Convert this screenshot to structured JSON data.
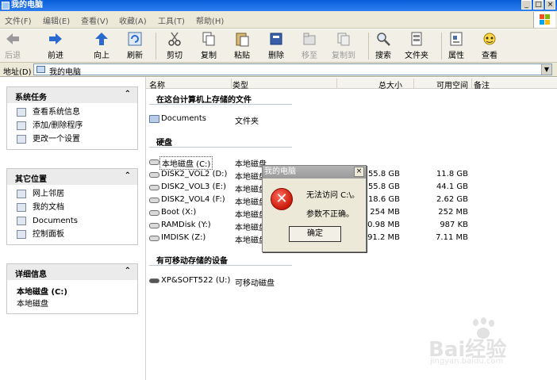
{
  "window": {
    "title": "我的电脑"
  },
  "menu": [
    {
      "label": "文件(F)"
    },
    {
      "label": "编辑(E)"
    },
    {
      "label": "查看(V)"
    },
    {
      "label": "收藏(A)"
    },
    {
      "label": "工具(T)"
    },
    {
      "label": "帮助(H)"
    }
  ],
  "toolbar": {
    "back": "后退",
    "forward": "前进",
    "up": "向上",
    "refresh": "刷新",
    "cut": "剪切",
    "copy": "复制",
    "paste": "粘贴",
    "delete": "删除",
    "move_to": "移至",
    "copy_to": "复制到",
    "search": "搜索",
    "folders": "文件夹",
    "properties": "属性",
    "view": "查看"
  },
  "address": {
    "label": "地址(D)",
    "value": "我的电脑"
  },
  "tasks_panel": {
    "title": "系统任务",
    "items": [
      {
        "label": "查看系统信息",
        "icon": "system-info-icon"
      },
      {
        "label": "添加/删除程序",
        "icon": "add-remove-programs-icon"
      },
      {
        "label": "更改一个设置",
        "icon": "change-setting-icon"
      }
    ]
  },
  "places_panel": {
    "title": "其它位置",
    "items": [
      {
        "label": "网上邻居",
        "icon": "network-icon"
      },
      {
        "label": "我的文档",
        "icon": "documents-icon"
      },
      {
        "label": "Documents",
        "icon": "folder-icon"
      },
      {
        "label": "控制面板",
        "icon": "control-panel-icon"
      }
    ]
  },
  "details_panel": {
    "title": "详细信息",
    "name": "本地磁盘 (C:)",
    "type": "本地磁盘"
  },
  "columns": {
    "name": "名称",
    "type": "类型",
    "total": "总大小",
    "free": "可用空间",
    "note": "备注"
  },
  "groups": {
    "stored_files": "在这台计算机上存储的文件",
    "hard_disks": "硬盘",
    "removable": "有可移动存储的设备"
  },
  "stored_files": [
    {
      "name": "Documents",
      "type": "文件夹"
    }
  ],
  "drives": [
    {
      "name": "本地磁盘 (C:)",
      "type": "本地磁盘",
      "total": "",
      "free": ""
    },
    {
      "name": "DISK2_VOL2 (D:)",
      "type": "本地磁盘",
      "total": "55.8 GB",
      "free": "11.8 GB"
    },
    {
      "name": "DISK2_VOL3 (E:)",
      "type": "本地磁盘",
      "total": "55.8 GB",
      "free": "44.1 GB"
    },
    {
      "name": "DISK2_VOL4 (F:)",
      "type": "本地磁盘",
      "total": "18.6 GB",
      "free": "2.62 GB"
    },
    {
      "name": "Boot (X:)",
      "type": "本地磁盘",
      "total": "254 MB",
      "free": "252 MB"
    },
    {
      "name": "RAMDisk (Y:)",
      "type": "本地磁盘",
      "total": "0.98 MB",
      "free": "987 KB"
    },
    {
      "name": "IMDISK (Z:)",
      "type": "本地磁盘",
      "total": "91.2 MB",
      "free": "7.11 MB"
    }
  ],
  "removable": [
    {
      "name": "XP&SOFT522 (U:)",
      "type": "可移动磁盘"
    }
  ],
  "dialog": {
    "title": "我的电脑",
    "line1": "无法访问 C:\\。",
    "line2": "参数不正确。",
    "ok": "确定"
  },
  "watermark": {
    "text": "Bai经验",
    "url": "jingyan.baidu.com"
  }
}
